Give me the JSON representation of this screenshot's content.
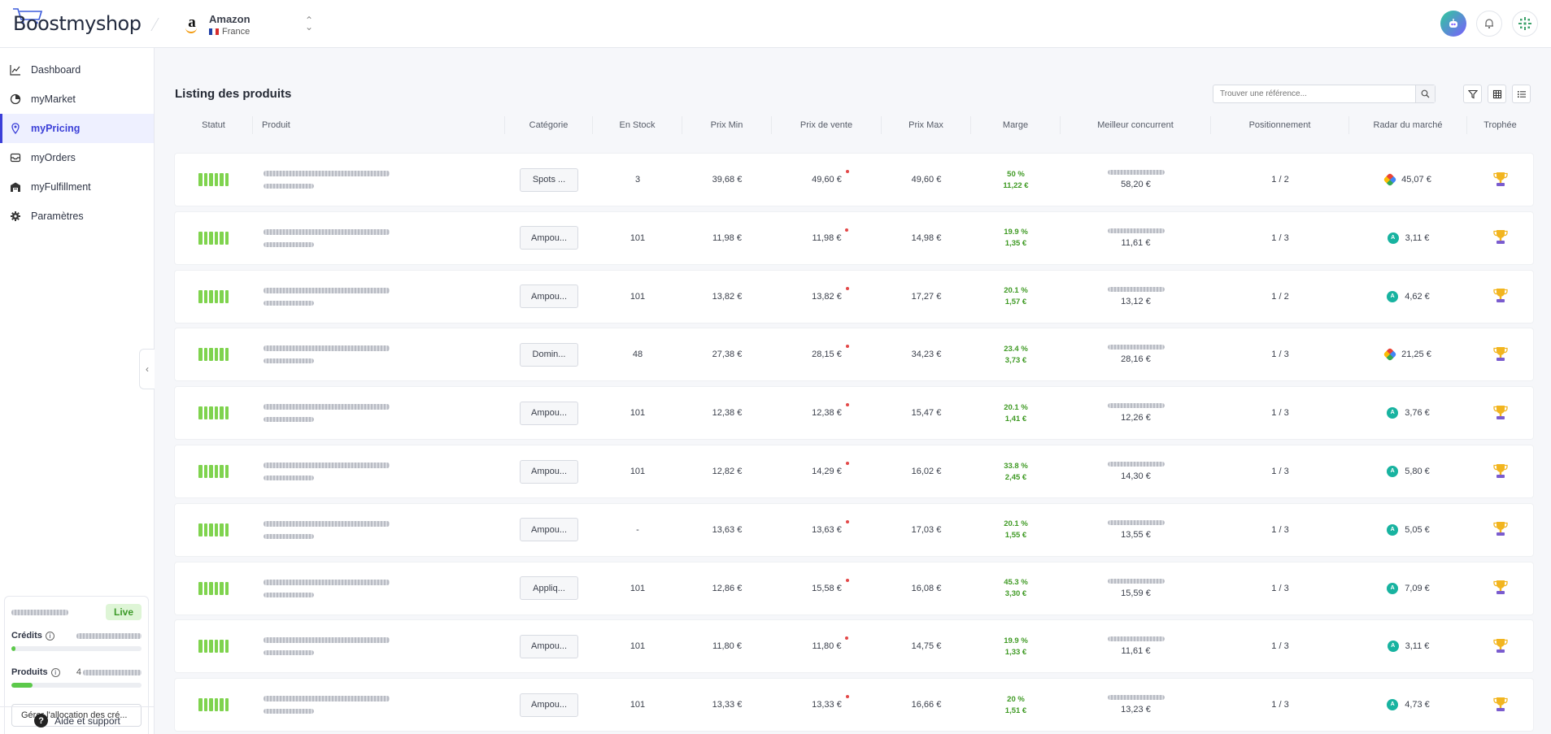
{
  "brand": {
    "logo_text": "Boostmyshop"
  },
  "store": {
    "name": "Amazon",
    "country": "France"
  },
  "sidebar": {
    "items": [
      {
        "label": "Dashboard",
        "icon": "chart-line-icon"
      },
      {
        "label": "myMarket",
        "icon": "pie-chart-icon"
      },
      {
        "label": "myPricing",
        "icon": "price-tag-icon",
        "active": true
      },
      {
        "label": "myOrders",
        "icon": "inbox-icon"
      },
      {
        "label": "myFulfillment",
        "icon": "warehouse-icon"
      },
      {
        "label": "Paramètres",
        "icon": "gear-icon"
      }
    ],
    "plan": {
      "badge": "Live",
      "credits_label": "Crédits",
      "credits_fill": 0.03,
      "products_label": "Produits",
      "products_prefix": "4",
      "products_fill": 0.16,
      "manage_button": "Gérer l'allocation des cré..."
    },
    "help": "Aide et support"
  },
  "main": {
    "title": "Listing des produits",
    "search_placeholder": "Trouver une référence...",
    "columns": [
      "Statut",
      "Produit",
      "Catégorie",
      "En Stock",
      "Prix Min",
      "Prix de vente",
      "Prix Max",
      "Marge",
      "Meilleur concurrent",
      "Positionnement",
      "Radar du marché",
      "Trophée"
    ]
  },
  "rows": [
    {
      "category": "Spots ...",
      "stock": "3",
      "min": "39,68 €",
      "sale": "49,60 €",
      "max": "49,60 €",
      "marge_pct": "50 %",
      "marge_val": "11,22 €",
      "competitor": "58,20 €",
      "position": "1 / 2",
      "radar_logo": "multi",
      "radar": "45,07 €"
    },
    {
      "category": "Ampou...",
      "stock": "101",
      "min": "11,98 €",
      "sale": "11,98 €",
      "max": "14,98 €",
      "marge_pct": "19.9 %",
      "marge_val": "1,35 €",
      "competitor": "11,61 €",
      "position": "1 / 3",
      "radar_logo": "teal",
      "radar": "3,11 €"
    },
    {
      "category": "Ampou...",
      "stock": "101",
      "min": "13,82 €",
      "sale": "13,82 €",
      "max": "17,27 €",
      "marge_pct": "20.1 %",
      "marge_val": "1,57 €",
      "competitor": "13,12 €",
      "position": "1 / 2",
      "radar_logo": "teal",
      "radar": "4,62 €"
    },
    {
      "category": "Domin...",
      "stock": "48",
      "min": "27,38 €",
      "sale": "28,15 €",
      "max": "34,23 €",
      "marge_pct": "23.4 %",
      "marge_val": "3,73 €",
      "competitor": "28,16 €",
      "position": "1 / 3",
      "radar_logo": "multi",
      "radar": "21,25 €"
    },
    {
      "category": "Ampou...",
      "stock": "101",
      "min": "12,38 €",
      "sale": "12,38 €",
      "max": "15,47 €",
      "marge_pct": "20.1 %",
      "marge_val": "1,41 €",
      "competitor": "12,26 €",
      "position": "1 / 3",
      "radar_logo": "teal",
      "radar": "3,76 €"
    },
    {
      "category": "Ampou...",
      "stock": "101",
      "min": "12,82 €",
      "sale": "14,29 €",
      "max": "16,02 €",
      "marge_pct": "33.8 %",
      "marge_val": "2,45 €",
      "competitor": "14,30 €",
      "position": "1 / 3",
      "radar_logo": "teal",
      "radar": "5,80 €"
    },
    {
      "category": "Ampou...",
      "stock": "-",
      "min": "13,63 €",
      "sale": "13,63 €",
      "max": "17,03 €",
      "marge_pct": "20.1 %",
      "marge_val": "1,55 €",
      "competitor": "13,55 €",
      "position": "1 / 3",
      "radar_logo": "teal",
      "radar": "5,05 €"
    },
    {
      "category": "Appliq...",
      "stock": "101",
      "min": "12,86 €",
      "sale": "15,58 €",
      "max": "16,08 €",
      "marge_pct": "45.3 %",
      "marge_val": "3,30 €",
      "competitor": "15,59 €",
      "position": "1 / 3",
      "radar_logo": "teal",
      "radar": "7,09 €"
    },
    {
      "category": "Ampou...",
      "stock": "101",
      "min": "11,80 €",
      "sale": "11,80 €",
      "max": "14,75 €",
      "marge_pct": "19.9 %",
      "marge_val": "1,33 €",
      "competitor": "11,61 €",
      "position": "1 / 3",
      "radar_logo": "teal",
      "radar": "3,11 €"
    },
    {
      "category": "Ampou...",
      "stock": "101",
      "min": "13,33 €",
      "sale": "13,33 €",
      "max": "16,66 €",
      "marge_pct": "20 %",
      "marge_val": "1,51 €",
      "competitor": "13,23 €",
      "position": "1 / 3",
      "radar_logo": "teal",
      "radar": "4,73 €"
    }
  ],
  "colors": {
    "accent": "#3b3fd8",
    "status_green": "#7fd34e",
    "margin_green": "#3f9a24",
    "live_bg": "#def5d6"
  }
}
